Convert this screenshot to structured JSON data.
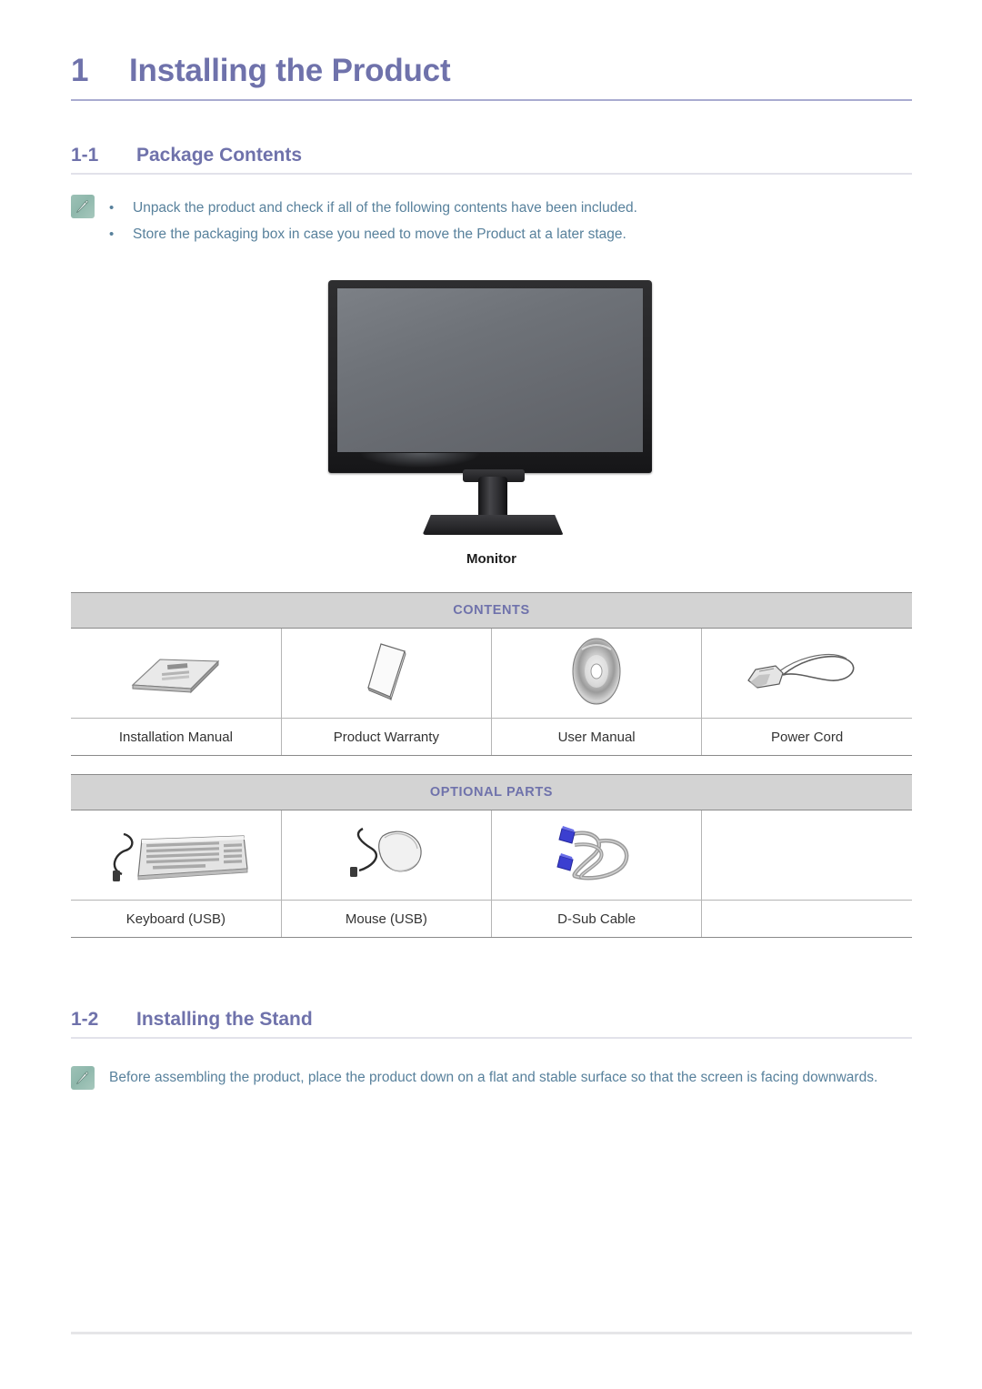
{
  "chapter": {
    "number": "1",
    "title": "Installing the Product"
  },
  "sections": [
    {
      "number": "1-1",
      "title": "Package Contents"
    },
    {
      "number": "1-2",
      "title": "Installing the Stand"
    }
  ],
  "note_package": {
    "icon": "note-pencil-icon",
    "bullet": "•",
    "items": [
      "Unpack the product and check if all of the following contents have been included.",
      "Store the packaging box in case you need to move the Product at a later stage."
    ]
  },
  "note_stand": {
    "icon": "note-pencil-icon",
    "text": "Before assembling the product, place the product down on a flat and stable surface so that the screen is facing downwards."
  },
  "monitor": {
    "label": "Monitor",
    "icon": "monitor-illustration"
  },
  "contents_table": {
    "header": "CONTENTS",
    "items": [
      {
        "label": "Installation Manual",
        "icon": "installation-manual-icon"
      },
      {
        "label": "Product Warranty",
        "icon": "product-warranty-icon"
      },
      {
        "label": "User Manual",
        "icon": "user-manual-cd-icon"
      },
      {
        "label": "Power Cord",
        "icon": "power-cord-icon"
      }
    ]
  },
  "optional_table": {
    "header": "OPTIONAL PARTS",
    "items": [
      {
        "label": "Keyboard (USB)",
        "icon": "keyboard-icon"
      },
      {
        "label": "Mouse (USB)",
        "icon": "mouse-icon"
      },
      {
        "label": "D-Sub Cable",
        "icon": "dsub-cable-icon"
      },
      {
        "label": "",
        "icon": ""
      }
    ]
  },
  "colors": {
    "heading": "#6f72ab",
    "body_text": "#58819c",
    "table_header_bg": "#d3d3d3",
    "note_icon_bg": "#9dc1b6",
    "label_text": "#333333"
  }
}
